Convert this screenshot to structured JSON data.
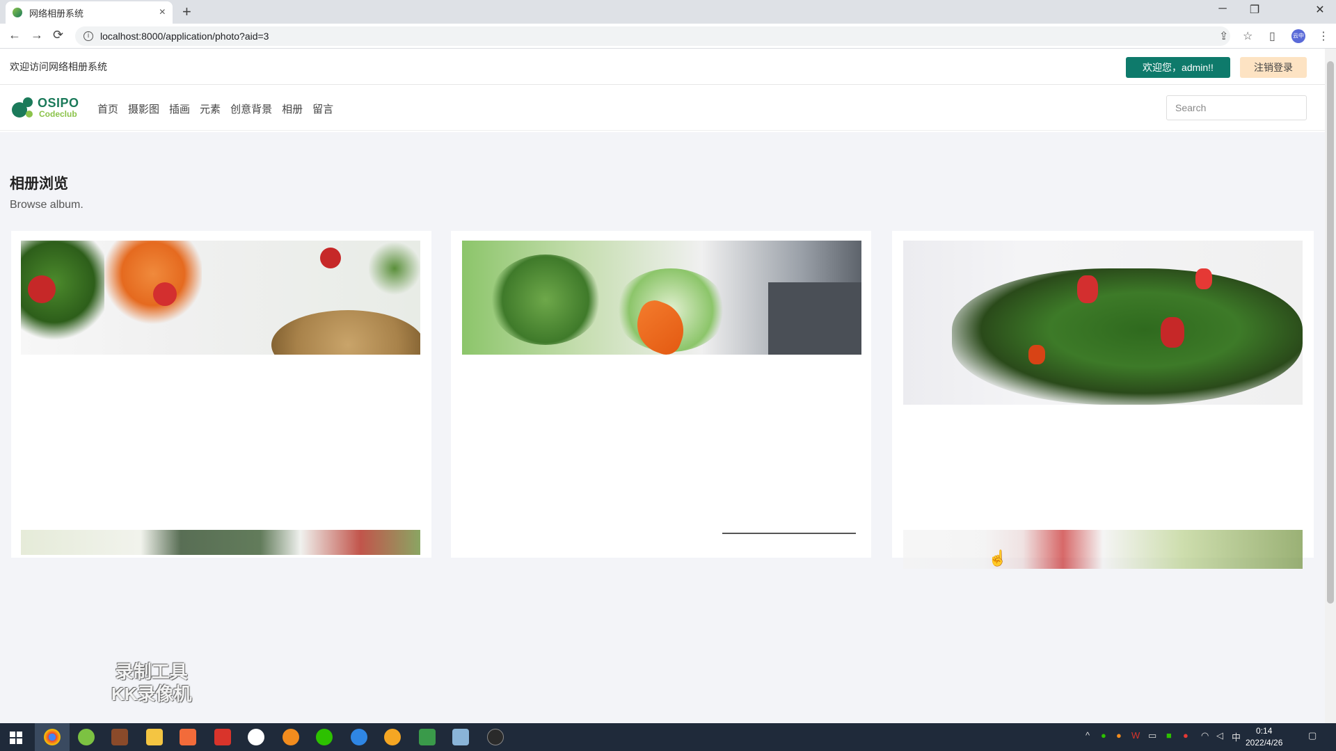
{
  "browser": {
    "tab_title": "网络相册系统",
    "tab_close": "×",
    "new_tab": "+",
    "url": "localhost:8000/application/photo?aid=3",
    "win_min": "─",
    "win_restore": "❐",
    "win_close": "✕",
    "back": "←",
    "forward": "→",
    "reload": "⟳",
    "profile": "云中"
  },
  "page": {
    "welcome_text": "欢迎访问网络相册系统",
    "welcome_button": "欢迎您，admin!!",
    "logout_button": "注销登录",
    "logo_top": "OSIPO",
    "logo_bottom": "Codeclub",
    "menu": [
      "首页",
      "摄影图",
      "插画",
      "元素",
      "创意背景",
      "相册",
      "留言"
    ],
    "search_placeholder": "Search",
    "section_title": "相册浏览",
    "section_subtitle": "Browse album."
  },
  "overlay": {
    "watermark_line1": "录制工具",
    "watermark_line2": "KK录像机"
  },
  "taskbar": {
    "time": "0:14",
    "date": "2022/4/26",
    "ime": "中"
  },
  "colors": {
    "accent": "#0e7a6b",
    "logout_bg": "#fde3c3",
    "hero_bg": "#f3f4f8"
  }
}
